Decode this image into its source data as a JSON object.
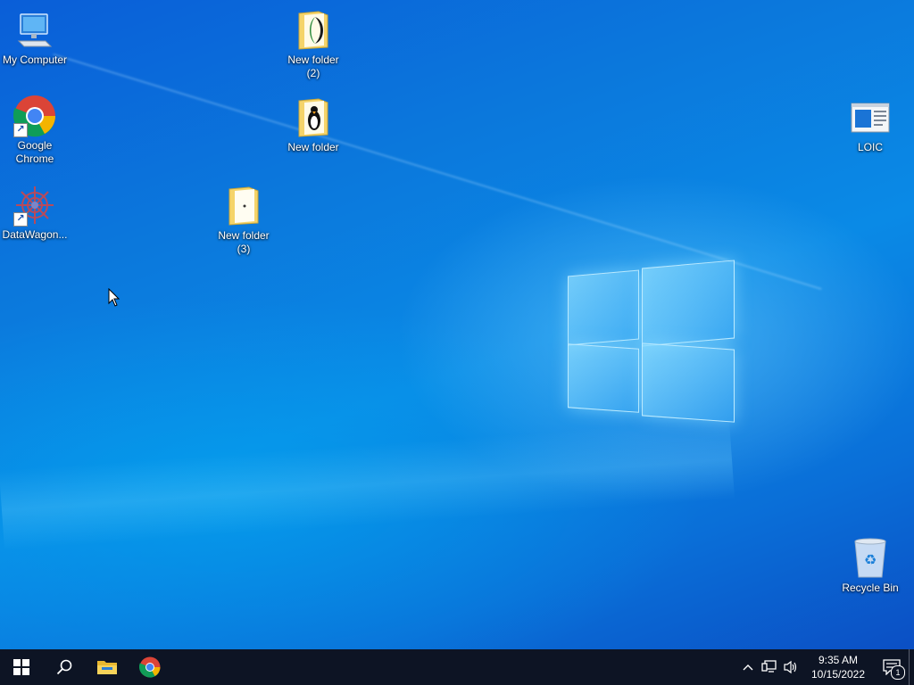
{
  "desktop": {
    "icons": [
      {
        "id": "my-computer",
        "label": "My Computer"
      },
      {
        "id": "google-chrome",
        "label": "Google\nChrome"
      },
      {
        "id": "datawagon",
        "label": "DataWagon..."
      },
      {
        "id": "new-folder-2",
        "label": "New folder\n(2)"
      },
      {
        "id": "new-folder",
        "label": "New folder"
      },
      {
        "id": "new-folder-3",
        "label": "New folder\n(3)"
      },
      {
        "id": "loic",
        "label": "LOIC"
      },
      {
        "id": "recycle-bin",
        "label": "Recycle Bin"
      }
    ]
  },
  "taskbar": {
    "buttons": [
      {
        "name": "start-button",
        "icon": "windows-logo-icon"
      },
      {
        "name": "search-button",
        "icon": "search-icon"
      },
      {
        "name": "file-explorer-button",
        "icon": "folder-icon"
      },
      {
        "name": "chrome-taskbar-button",
        "icon": "chrome-icon"
      }
    ],
    "tray": {
      "time": "9:35 AM",
      "date": "10/15/2022",
      "notification_count": "1"
    }
  },
  "colors": {
    "taskbar_bg": "#0d1424",
    "desktop_accent": "#0a78dc"
  }
}
